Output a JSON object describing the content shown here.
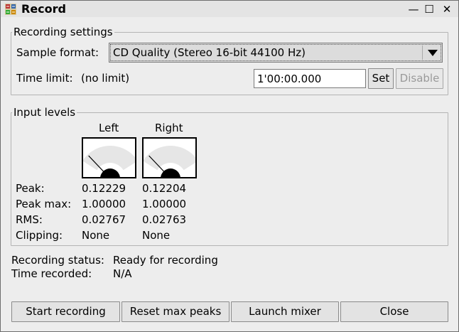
{
  "window": {
    "title": "Record",
    "minimize_glyph": "—",
    "maximize_glyph": "☐",
    "close_glyph": "✕"
  },
  "settings": {
    "legend": "Recording settings",
    "sample_format_label": "Sample format:",
    "sample_format_value": "CD Quality (Stereo 16-bit 44100 Hz)",
    "time_limit_label": "Time limit:",
    "time_limit_status": "(no limit)",
    "time_limit_value": "1'00:00.000",
    "set_label": "Set",
    "disable_label": "Disable"
  },
  "levels": {
    "legend": "Input levels",
    "channels": [
      {
        "name": "Left",
        "level": 0.12229,
        "peak": "0.12229",
        "peak_max": "1.00000",
        "rms": "0.02767",
        "clipping": "None"
      },
      {
        "name": "Right",
        "level": 0.12204,
        "peak": "0.12204",
        "peak_max": "1.00000",
        "rms": "0.02763",
        "clipping": "None"
      }
    ],
    "row_labels": {
      "peak": "Peak:",
      "peak_max": "Peak max:",
      "rms": "RMS:",
      "clipping": "Clipping:"
    }
  },
  "status": {
    "recording_label": "Recording status:",
    "recording_value": "Ready for recording",
    "time_label": "Time recorded:",
    "time_value": "N/A"
  },
  "buttons": {
    "start": "Start recording",
    "reset": "Reset max peaks",
    "mixer": "Launch mixer",
    "close": "Close"
  }
}
